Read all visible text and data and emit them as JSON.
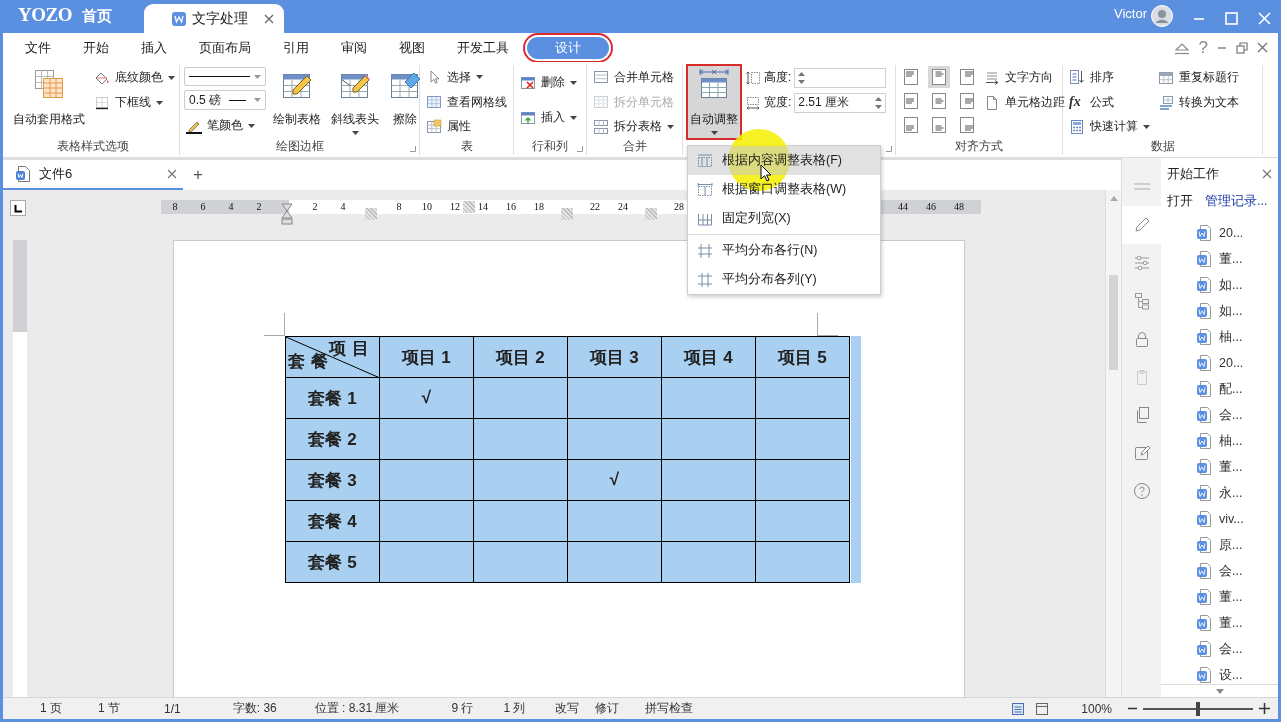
{
  "title_bar": {
    "logo": "YOZO",
    "home": "首页",
    "app_tab": {
      "label": "文字处理",
      "selected": true
    },
    "user": "Victor"
  },
  "menu_bar": {
    "tabs": [
      {
        "label": "文件",
        "selected": false,
        "outlined": false
      },
      {
        "label": "开始",
        "selected": false,
        "outlined": false
      },
      {
        "label": "插入",
        "selected": false,
        "outlined": false
      },
      {
        "label": "页面布局",
        "selected": false,
        "outlined": false
      },
      {
        "label": "引用",
        "selected": false,
        "outlined": false
      },
      {
        "label": "审阅",
        "selected": false,
        "outlined": false
      },
      {
        "label": "视图",
        "selected": false,
        "outlined": false
      },
      {
        "label": "开发工具",
        "selected": false,
        "outlined": false
      },
      {
        "label": "设计",
        "selected": true,
        "outlined": true
      }
    ],
    "help": "?"
  },
  "ribbon": {
    "groups": [
      {
        "label": "表格样式选项",
        "launcher": false,
        "columns": [
          [
            {
              "kind": "large",
              "label": "自动套用格式",
              "dropdown": false,
              "pressed": false,
              "outlined": false
            }
          ],
          [
            {
              "kind": "small",
              "label": "底纹颜色",
              "dropdown": true,
              "disabled": false
            },
            {
              "kind": "small",
              "label": "下框线",
              "dropdown": true,
              "disabled": false
            }
          ]
        ]
      },
      {
        "label": "绘图边框",
        "launcher": true,
        "columns": [
          [
            {
              "kind": "line-style"
            },
            {
              "kind": "line-width",
              "value": "0.5",
              "unit": "磅"
            },
            {
              "kind": "small",
              "label": "笔颜色",
              "dropdown": true,
              "disabled": false
            }
          ],
          [
            {
              "kind": "large",
              "label": "绘制表格",
              "dropdown": false,
              "pressed": false,
              "outlined": false
            }
          ],
          [
            {
              "kind": "large",
              "label": "斜线表头",
              "dropdown": true,
              "pressed": false,
              "outlined": false
            }
          ],
          [
            {
              "kind": "large",
              "label": "擦除",
              "dropdown": false,
              "pressed": false,
              "outlined": false
            }
          ]
        ]
      },
      {
        "label": "表",
        "launcher": false,
        "columns": [
          [
            {
              "kind": "small",
              "label": "选择",
              "dropdown": true,
              "disabled": false
            },
            {
              "kind": "small",
              "label": "查看网格线",
              "dropdown": false,
              "disabled": false
            },
            {
              "kind": "small",
              "label": "属性",
              "dropdown": false,
              "disabled": false
            }
          ]
        ]
      },
      {
        "label": "行和列",
        "launcher": true,
        "columns": [
          [
            {
              "kind": "small",
              "label": "删除",
              "dropdown": true,
              "disabled": false
            },
            {
              "kind": "small",
              "label": "插入",
              "dropdown": true,
              "disabled": false
            }
          ]
        ]
      },
      {
        "label": "合并",
        "launcher": false,
        "columns": [
          [
            {
              "kind": "small",
              "label": "合并单元格",
              "dropdown": false,
              "disabled": false
            },
            {
              "kind": "small",
              "label": "拆分单元格",
              "dropdown": false,
              "disabled": true
            },
            {
              "kind": "small",
              "label": "拆分表格",
              "dropdown": true,
              "disabled": false
            }
          ]
        ]
      },
      {
        "launcher": true,
        "columns": [
          [
            {
              "kind": "large",
              "label": "自动调整",
              "dropdown": true,
              "pressed": true,
              "outlined": true
            }
          ],
          [
            {
              "kind": "field",
              "label": "高度:"
            },
            {
              "kind": "field",
              "label": "宽度:",
              "value": "2.51 厘米"
            }
          ]
        ]
      },
      {
        "label": "对齐方式",
        "launcher": false,
        "columns": [
          [
            {
              "kind": "align-grid",
              "cells": [
                {
                  "selected": false
                },
                {
                  "selected": true
                },
                {
                  "selected": false
                },
                {
                  "selected": false
                },
                {
                  "selected": false
                },
                {
                  "selected": false
                },
                {
                  "selected": false
                },
                {
                  "selected": false
                },
                {
                  "selected": false
                }
              ]
            }
          ],
          [
            {
              "kind": "small",
              "label": "文字方向",
              "dropdown": false,
              "disabled": false
            },
            {
              "kind": "small",
              "label": "单元格边距",
              "dropdown": false,
              "disabled": false
            }
          ]
        ]
      },
      {
        "label": "数据",
        "launcher": false,
        "columns": [
          [
            {
              "kind": "small",
              "label": "排序",
              "dropdown": false,
              "disabled": false
            },
            {
              "kind": "small",
              "label": "公式",
              "glyph": "fx",
              "dropdown": false,
              "disabled": false
            },
            {
              "kind": "small",
              "label": "快速计算",
              "dropdown": true,
              "disabled": false
            }
          ],
          [
            {
              "kind": "small",
              "label": "重复标题行",
              "dropdown": false,
              "disabled": false
            },
            {
              "kind": "small",
              "label": "转换为文本",
              "dropdown": false,
              "disabled": false
            }
          ]
        ]
      }
    ]
  },
  "autofit_menu": {
    "sections": [
      [
        {
          "label": "根据内容调整表格(F)",
          "selected": true
        },
        {
          "label": "根据窗口调整表格(W)",
          "selected": false
        },
        {
          "label": "固定列宽(X)",
          "selected": false
        }
      ],
      [
        {
          "label": "平均分布各行(N)",
          "selected": false
        },
        {
          "label": "平均分布各列(Y)",
          "selected": false
        }
      ]
    ]
  },
  "document_tabs": {
    "tabs": [
      {
        "label": "文件6",
        "selected": true
      }
    ],
    "new_tab": "+"
  },
  "ruler": [
    {
      "kind": "number",
      "label": "8"
    },
    {
      "kind": "number",
      "label": "6"
    },
    {
      "kind": "number",
      "label": "4"
    },
    {
      "kind": "number",
      "label": "2"
    },
    {
      "kind": "indent"
    },
    {
      "kind": "number",
      "label": "2"
    },
    {
      "kind": "number",
      "label": "4"
    },
    {
      "kind": "marker"
    },
    {
      "kind": "number",
      "label": "8"
    },
    {
      "kind": "number",
      "label": "10"
    },
    {
      "kind": "number",
      "label": "12"
    },
    {
      "kind": "split"
    },
    {
      "kind": "number",
      "label": "14"
    },
    {
      "kind": "number",
      "label": "16"
    },
    {
      "kind": "number",
      "label": "18"
    },
    {
      "kind": "marker"
    },
    {
      "kind": "number",
      "label": "22"
    },
    {
      "kind": "number",
      "label": "24"
    },
    {
      "kind": "marker"
    },
    {
      "kind": "number",
      "label": "28"
    },
    {
      "kind": "gap"
    },
    {
      "kind": "gap"
    },
    {
      "kind": "gap"
    },
    {
      "kind": "gap"
    },
    {
      "kind": "gap"
    },
    {
      "kind": "gap"
    },
    {
      "kind": "gap"
    },
    {
      "kind": "number",
      "label": "44"
    },
    {
      "kind": "number",
      "label": "46"
    },
    {
      "kind": "number",
      "label": "48"
    }
  ],
  "table": {
    "selected": true,
    "corner": {
      "column_title": "项目",
      "row_title": "套餐"
    },
    "columns": [
      "项目 1",
      "项目 2",
      "项目 3",
      "项目 4",
      "项目 5"
    ],
    "rows": [
      {
        "label": "套餐 1",
        "cells": [
          {
            "text": "√"
          },
          {},
          {},
          {},
          {}
        ]
      },
      {
        "label": "套餐 2",
        "cells": [
          {},
          {},
          {},
          {},
          {}
        ]
      },
      {
        "label": "套餐 3",
        "cells": [
          {},
          {},
          {
            "text": "√"
          },
          {},
          {}
        ]
      },
      {
        "label": "套餐 4",
        "cells": [
          {},
          {},
          {},
          {},
          {}
        ]
      },
      {
        "label": "套餐 5",
        "cells": [
          {},
          {},
          {},
          {},
          {}
        ]
      }
    ]
  },
  "side_panel": {
    "title": "开始工作",
    "open": "打开",
    "manage": "管理记录...",
    "files": [
      "20...",
      "董...",
      "如...",
      "如...",
      "柚...",
      "20...",
      "配...",
      "会...",
      "柚...",
      "董...",
      "永...",
      "viv...",
      "原...",
      "会...",
      "董...",
      "董...",
      "会...",
      "设..."
    ]
  },
  "status_bar": {
    "items": [
      "1 页",
      "1 节",
      "1/1",
      "字数: 36",
      "位置 : 8.31 厘米",
      "9 行",
      "1 列",
      "改写",
      "修订",
      "拼写检查"
    ],
    "zoom": {
      "label": "100%",
      "level": 0.5
    }
  }
}
